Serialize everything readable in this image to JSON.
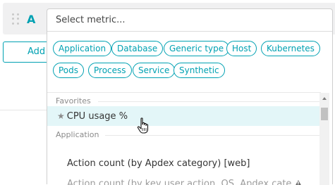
{
  "query": {
    "letter": "A",
    "add_button_label": "Add"
  },
  "metric_selector": {
    "placeholder": "Select metric...",
    "chips": [
      "Application",
      "Database",
      "Generic type",
      "Host",
      "Kubernetes",
      "Pods",
      "Process",
      "Service",
      "Synthetic"
    ],
    "favorites_header": "Favorites",
    "favorite_item": "CPU usage %",
    "application_header": "Application",
    "application_items": [
      "Action count (by Apdex category) [web]",
      "Action count (by key user action, OS, Apdex cate..."
    ]
  },
  "colors": {
    "accent": "#00a1b2",
    "highlight": "#e3f6f8"
  },
  "icons": [
    "drag-handle-icon",
    "star-icon",
    "warning-icon",
    "hand-cursor-icon"
  ]
}
